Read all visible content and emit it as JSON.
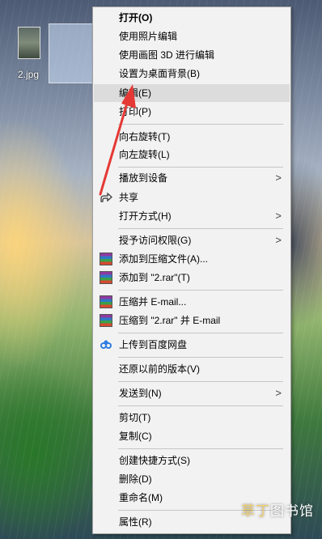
{
  "desktop": {
    "file_label": "2.jpg"
  },
  "menu": {
    "items": [
      {
        "label": "打开(O)"
      },
      {
        "label": "使用照片编辑"
      },
      {
        "label": "使用画图 3D 进行编辑"
      },
      {
        "label": "设置为桌面背景(B)"
      },
      {
        "label": "编辑(E)"
      },
      {
        "label": "打印(P)"
      },
      {
        "label": "向右旋转(T)"
      },
      {
        "label": "向左旋转(L)"
      },
      {
        "label": "播放到设备"
      },
      {
        "label": "共享"
      },
      {
        "label": "打开方式(H)"
      },
      {
        "label": "授予访问权限(G)"
      },
      {
        "label": "添加到压缩文件(A)..."
      },
      {
        "label": "添加到 \"2.rar\"(T)"
      },
      {
        "label": "压缩并 E-mail..."
      },
      {
        "label": "压缩到 \"2.rar\" 并 E-mail"
      },
      {
        "label": "上传到百度网盘"
      },
      {
        "label": "还原以前的版本(V)"
      },
      {
        "label": "发送到(N)"
      },
      {
        "label": "剪切(T)"
      },
      {
        "label": "复制(C)"
      },
      {
        "label": "创建快捷方式(S)"
      },
      {
        "label": "删除(D)"
      },
      {
        "label": "重命名(M)"
      },
      {
        "label": "属性(R)"
      }
    ],
    "submenu_arrow": ">"
  },
  "watermark": {
    "part1": "草丁",
    "part2": "图书馆"
  },
  "colors": {
    "menu_bg": "#f2f2f2",
    "highlight": "#dcdcdc",
    "annotation_arrow": "#e53935"
  }
}
